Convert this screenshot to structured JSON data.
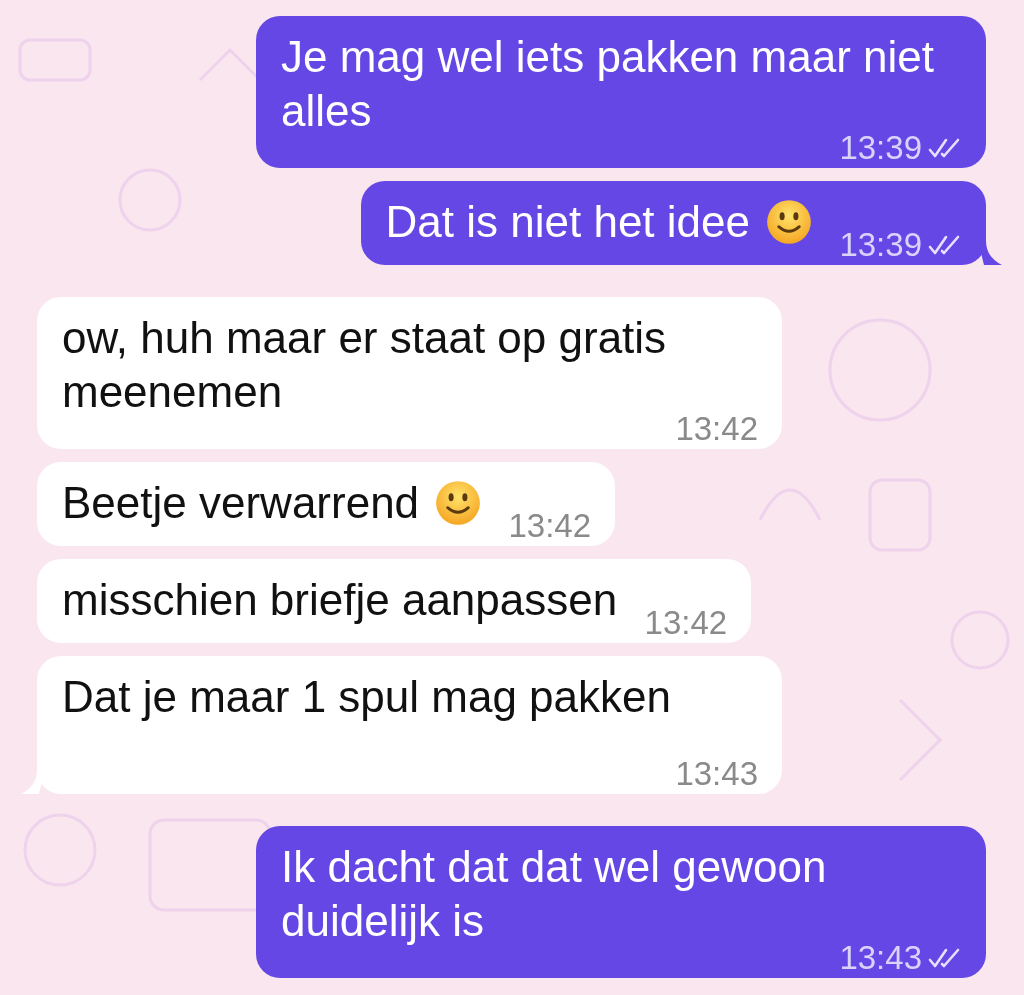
{
  "messages": [
    {
      "kind": "sent",
      "text": "Je mag wel iets pakken maar niet alles",
      "emoji": false,
      "time": "13:39",
      "read": true,
      "tail": false
    },
    {
      "kind": "sent",
      "text": "Dat is niet het idee",
      "emoji": true,
      "time": "13:39",
      "read": true,
      "tail": true
    },
    {
      "kind": "received",
      "text": "ow, huh maar er staat op gratis meenemen",
      "emoji": false,
      "time": "13:42",
      "read": false,
      "tail": false
    },
    {
      "kind": "received",
      "text": "Beetje verwarrend",
      "emoji": true,
      "time": "13:42",
      "read": false,
      "tail": false
    },
    {
      "kind": "received",
      "text": "misschien briefje aanpassen",
      "emoji": false,
      "time": "13:42",
      "read": false,
      "tail": false
    },
    {
      "kind": "received",
      "text": "Dat je maar 1 spul mag pakken",
      "emoji": false,
      "time": "13:43",
      "read": false,
      "tail": true
    },
    {
      "kind": "sent",
      "text": "Ik dacht dat dat wel gewoon duidelijk is",
      "emoji": false,
      "time": "13:43",
      "read": true,
      "tail": false
    }
  ]
}
